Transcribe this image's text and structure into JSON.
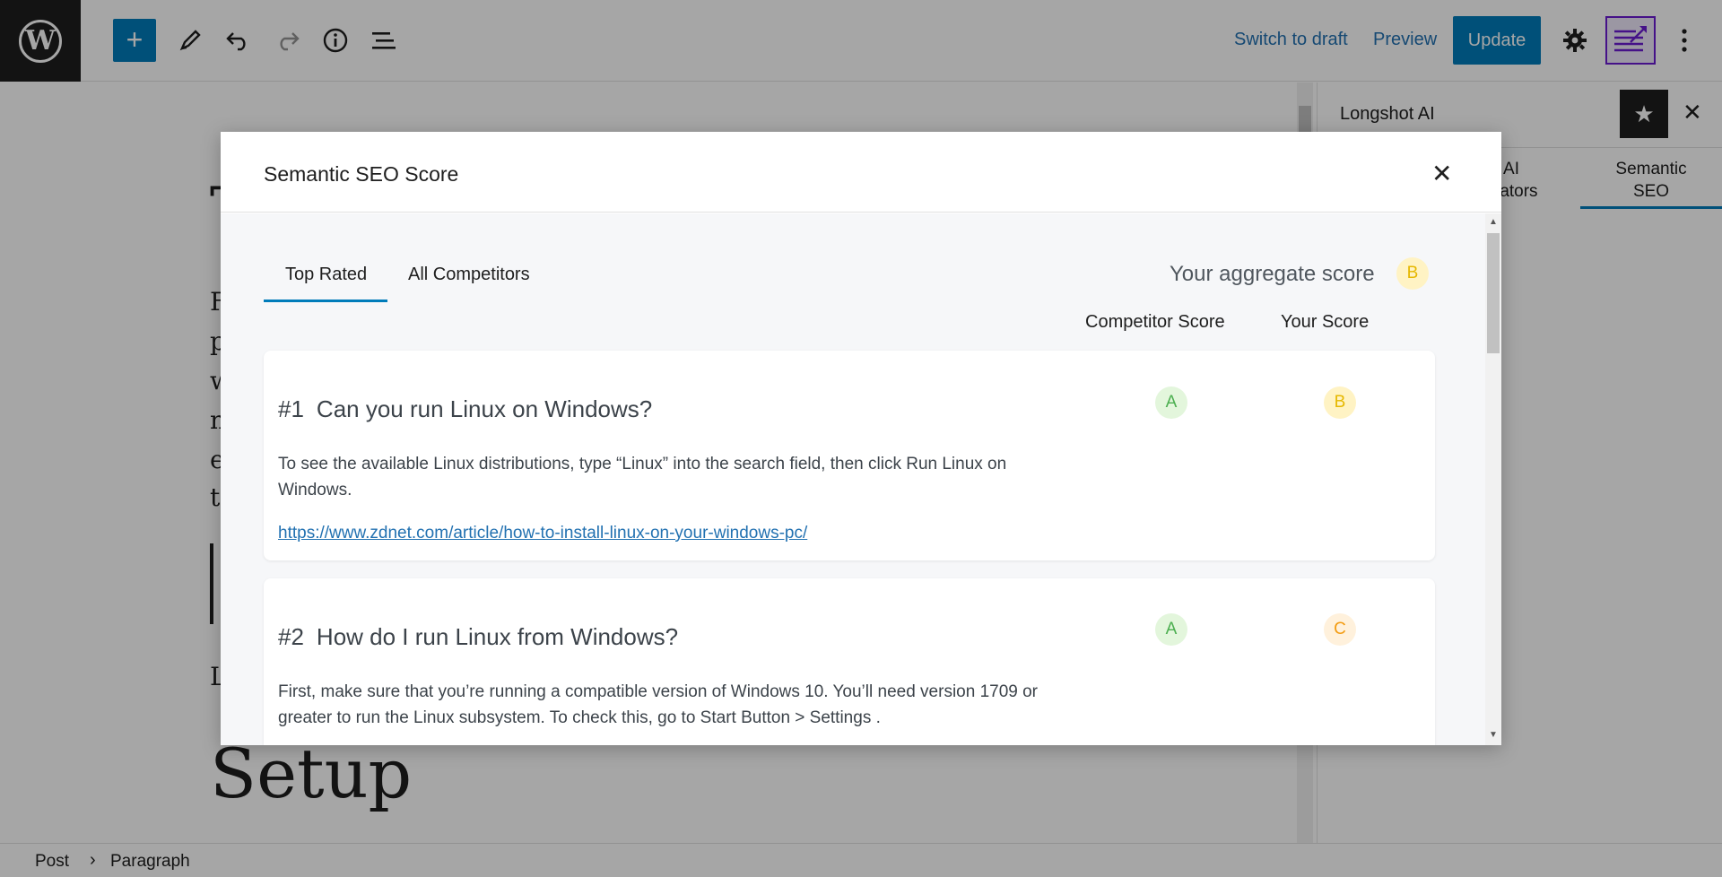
{
  "topbar": {
    "add_label": "+",
    "switch_to_draft": "Switch to draft",
    "preview": "Preview",
    "update": "Update"
  },
  "editor": {
    "title_letter": "T",
    "para_letters": [
      "F",
      "p",
      "w",
      "n",
      "e",
      "t"
    ],
    "list_letter": "L",
    "setup_heading": "Setup"
  },
  "sidebar": {
    "title": "Longshot AI",
    "tabs": [
      {
        "label": "AI\nerators"
      },
      {
        "label": "Semantic\nSEO"
      }
    ]
  },
  "breadcrumb": {
    "items": [
      "Post",
      "Paragraph"
    ]
  },
  "modal": {
    "title": "Semantic SEO Score",
    "tabs": [
      "Top Rated",
      "All Competitors"
    ],
    "aggregate_label": "Your aggregate score",
    "aggregate_grade": "B",
    "col_competitor": "Competitor Score",
    "col_yours": "Your Score",
    "cards": [
      {
        "num": "#1",
        "question": "Can you run Linux on Windows?",
        "description": "To see the available Linux distributions, type “Linux” into the search field, then click Run Linux on Windows.",
        "link": "https://www.zdnet.com/article/how-to-install-linux-on-your-windows-pc/",
        "competitor_grade": "A",
        "your_grade": "B"
      },
      {
        "num": "#2",
        "question": "How do I run Linux from Windows?",
        "description": "First, make sure that you’re running a compatible version of Windows 10. You’ll need version 1709 or greater to run the Linux subsystem. To check this, go to Start Button > Settings .",
        "link": "",
        "competitor_grade": "A",
        "your_grade": "C"
      }
    ]
  },
  "colors": {
    "accent": "#007cba",
    "brand_purple": "#6a1bd1",
    "grade_a": "#4caf50",
    "grade_b": "#e6b800",
    "grade_c": "#f39c12"
  }
}
